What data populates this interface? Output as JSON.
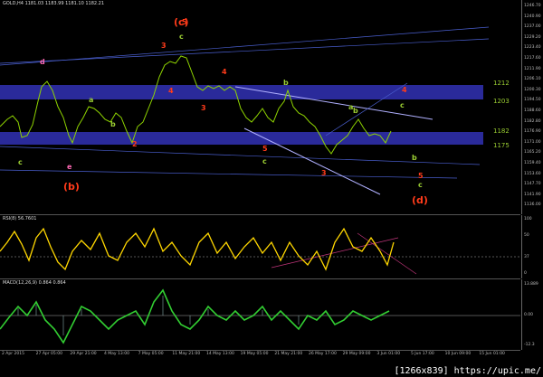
{
  "main_title": "GOLD,H4  1181.03 1183.99 1181.10 1182.21",
  "rsi_title": "RSI(8) 56.7601",
  "macd_title": "MACD(12,26,9) 0.864 0.864",
  "price_ticks": [
    "1246.70",
    "1240.90",
    "1237.00",
    "1229.20",
    "1223.40",
    "1217.60",
    "1211.90",
    "1206.10",
    "1200.30",
    "1194.50",
    "1188.60",
    "1182.80",
    "1176.90",
    "1171.00",
    "1165.20",
    "1159.40",
    "1153.60",
    "1147.70",
    "1141.90",
    "1136.00"
  ],
  "rsi_ticks": [
    "100",
    "50",
    "37",
    "0"
  ],
  "macd_ticks": [
    "13.889",
    "0.00",
    "-12.3"
  ],
  "time_ticks": [
    "2 Apr 2015",
    "27 Apr 05:00",
    "29 Apr 21:00",
    "4 May 13:00",
    "7 May 05:00",
    "11 May 21:00",
    "14 May 13:00",
    "19 May 05:00",
    "21 May 21:00",
    "26 May 17:00",
    "29 May 09:00",
    "3 Jun 01:00",
    "5 Jun 17:00",
    "10 Jun 09:00",
    "15 Jun 01:00"
  ],
  "zones": [
    {
      "label": "1212"
    },
    {
      "label": "1203"
    },
    {
      "label": "1182"
    },
    {
      "label": "1175"
    }
  ],
  "wave_labels": {
    "c_major": "(c)",
    "b_major": "(b)",
    "d_major": "(d)",
    "d": "d",
    "c1": "c",
    "e": "e",
    "c2": "c",
    "c3": "c",
    "b1": "b",
    "b2": "b",
    "n3": "3",
    "n5": "5",
    "n4": "4",
    "n4b": "4",
    "n3b": "3",
    "n2": "2",
    "n5b": "5",
    "n3c": "3",
    "a1": "a",
    "b3": "b",
    "c4": "c",
    "n4c": "4",
    "n5c": "5",
    "c5": "c",
    "a2": "a",
    "b4": "b"
  },
  "watermark": "[1266x839] https://upic.me/"
}
